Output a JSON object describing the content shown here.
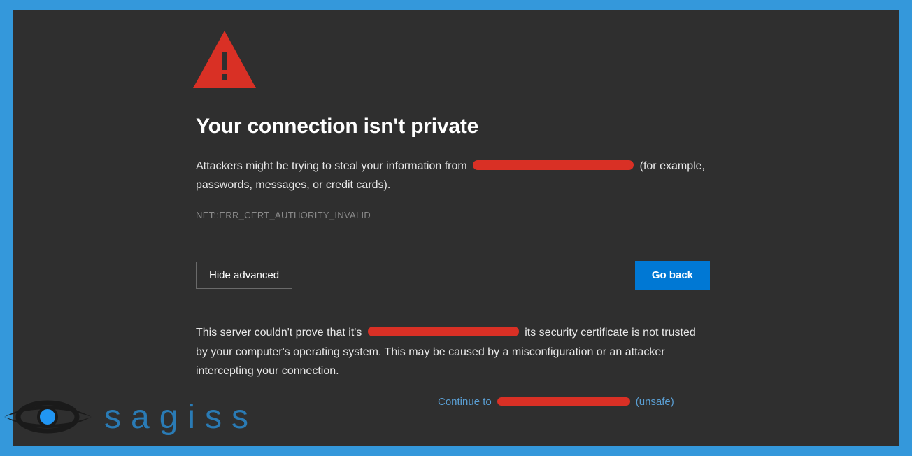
{
  "heading": "Your connection isn't private",
  "description_prefix": "Attackers might be trying to steal your information from",
  "description_suffix": "(for example, passwords, messages, or credit cards).",
  "error_code": "NET::ERR_CERT_AUTHORITY_INVALID",
  "buttons": {
    "hide_advanced": "Hide advanced",
    "go_back": "Go back"
  },
  "advanced_prefix": "This server couldn't prove that it's",
  "advanced_suffix": "its security certificate is not trusted by your computer's operating system. This may be caused by a misconfiguration or an attacker intercepting your connection.",
  "continue_prefix": "Continue to",
  "continue_suffix": "(unsafe)",
  "logo_text": "sagiss"
}
